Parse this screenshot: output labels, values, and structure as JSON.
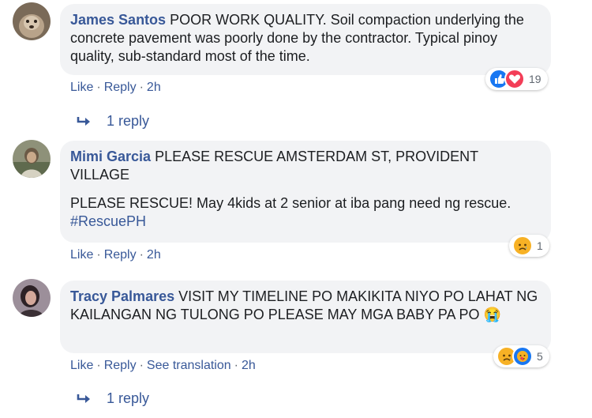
{
  "comments": [
    {
      "author": "James Santos",
      "paragraphs": [
        "POOR WORK QUALITY. Soil compaction underlying the concrete pavement was poorly done by the contractor. Typical pinoy quality, sub-standard most of the time."
      ],
      "actions": {
        "like": "Like",
        "reply": "Reply",
        "time": "2h"
      },
      "reactions": {
        "icons": [
          "like-reaction-icon",
          "love-reaction-icon"
        ],
        "count": "19"
      },
      "replies": "1 reply"
    },
    {
      "author": "Mimi Garcia",
      "paragraphs": [
        "PLEASE RESCUE AMSTERDAM ST, PROVIDENT VILLAGE",
        "PLEASE RESCUE! May 4kids at 2 senior at iba pang need ng rescue."
      ],
      "hashtag": "#RescuePH",
      "actions": {
        "like": "Like",
        "reply": "Reply",
        "time": "2h"
      },
      "reactions": {
        "icons": [
          "sad-reaction-icon"
        ],
        "count": "1"
      }
    },
    {
      "author": "Tracy Palmares",
      "paragraphs": [
        "VISIT MY TIMELINE PO MAKIKITA NIYO PO LAHAT NG KAILANGAN NG TULONG PO PLEASE MAY MGA BABY PA PO"
      ],
      "emoji": "😭",
      "actions": {
        "like": "Like",
        "reply": "Reply",
        "translate": "See translation",
        "time": "2h"
      },
      "reactions": {
        "icons": [
          "sad-reaction-icon",
          "care-reaction-icon"
        ],
        "count": "5"
      },
      "replies": "1 reply"
    }
  ],
  "colors": {
    "link": "#385898",
    "bubble": "#f2f3f5",
    "meta": "#606770",
    "like_blue": "#1877f2",
    "love_red": "#f33e58",
    "sad_yellow": "#f7b125"
  }
}
